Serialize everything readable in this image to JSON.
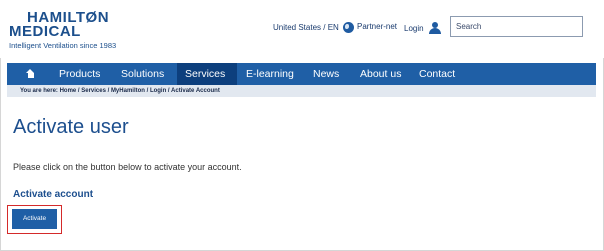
{
  "logo": {
    "line1": "HAMILTØN",
    "line2": "MEDICAL",
    "tagline": "Intelligent Ventilation since 1983"
  },
  "utility": {
    "language": "United States / EN",
    "partner": "Partner-net",
    "login": "Login",
    "search_placeholder": "Search"
  },
  "nav": {
    "items": [
      "Products",
      "Solutions",
      "Services",
      "E-learning",
      "News",
      "About us",
      "Contact"
    ],
    "active": "Services"
  },
  "breadcrumb": {
    "prefix": "You are here:",
    "trail": "Home / Services / MyHamilton / Login / Activate Account"
  },
  "main": {
    "title": "Activate user",
    "instruction": "Please click on the button below to activate your account.",
    "section_title": "Activate account",
    "button_label": "Activate"
  },
  "colors": {
    "brand_blue": "#1f5fa6",
    "nav_active": "#0d3f7d",
    "highlight": "#d42a2a"
  }
}
